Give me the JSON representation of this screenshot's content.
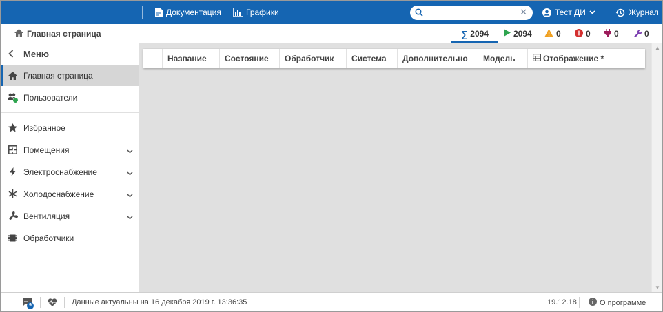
{
  "topbar": {
    "docs_label": "Документация",
    "charts_label": "Графики",
    "search": {
      "value": "",
      "placeholder": ""
    },
    "user_label": "Тест ДИ",
    "journal_label": "Журнал",
    "bg_color": "#1565b2"
  },
  "breadcrumb": {
    "label": "Главная страница"
  },
  "stats": [
    {
      "icon": "sigma-icon",
      "value": "2094",
      "color": "#1565b2"
    },
    {
      "icon": "play-icon",
      "value": "2094",
      "color": "#2ea44f"
    },
    {
      "icon": "warning-icon",
      "value": "0",
      "color": "#f0a020"
    },
    {
      "icon": "alert-circle-icon",
      "value": "0",
      "color": "#d32f2f"
    },
    {
      "icon": "plug-icon",
      "value": "0",
      "color": "#9c1b5a"
    },
    {
      "icon": "wrench-icon",
      "value": "0",
      "color": "#7b3fb0"
    }
  ],
  "sidebar": {
    "menu_label": "Меню",
    "items": [
      {
        "label": "Главная страница",
        "icon": "home-icon",
        "active": true
      },
      {
        "label": "Пользователи",
        "icon": "users-icon"
      },
      {
        "label": "Избранное",
        "icon": "star-icon"
      },
      {
        "label": "Помещения",
        "icon": "floorplan-icon",
        "expandable": true
      },
      {
        "label": "Электроснабжение",
        "icon": "lightning-icon",
        "expandable": true
      },
      {
        "label": "Холодоснабжение",
        "icon": "snowflake-icon",
        "expandable": true
      },
      {
        "label": "Вентиляция",
        "icon": "fan-icon",
        "expandable": true
      },
      {
        "label": "Обработчики",
        "icon": "chip-icon"
      }
    ],
    "users_badge": "6"
  },
  "table": {
    "columns": [
      "",
      "Название",
      "Состояние",
      "Обработчик",
      "Система",
      "Дополнительно",
      "Модель",
      "Отображение *"
    ]
  },
  "footer": {
    "messages_badge": "9",
    "status_text": "Данные актуальны на 16 декабря 2019 г. 13:36:35",
    "version": "19.12.18",
    "about_label": "О программе"
  }
}
